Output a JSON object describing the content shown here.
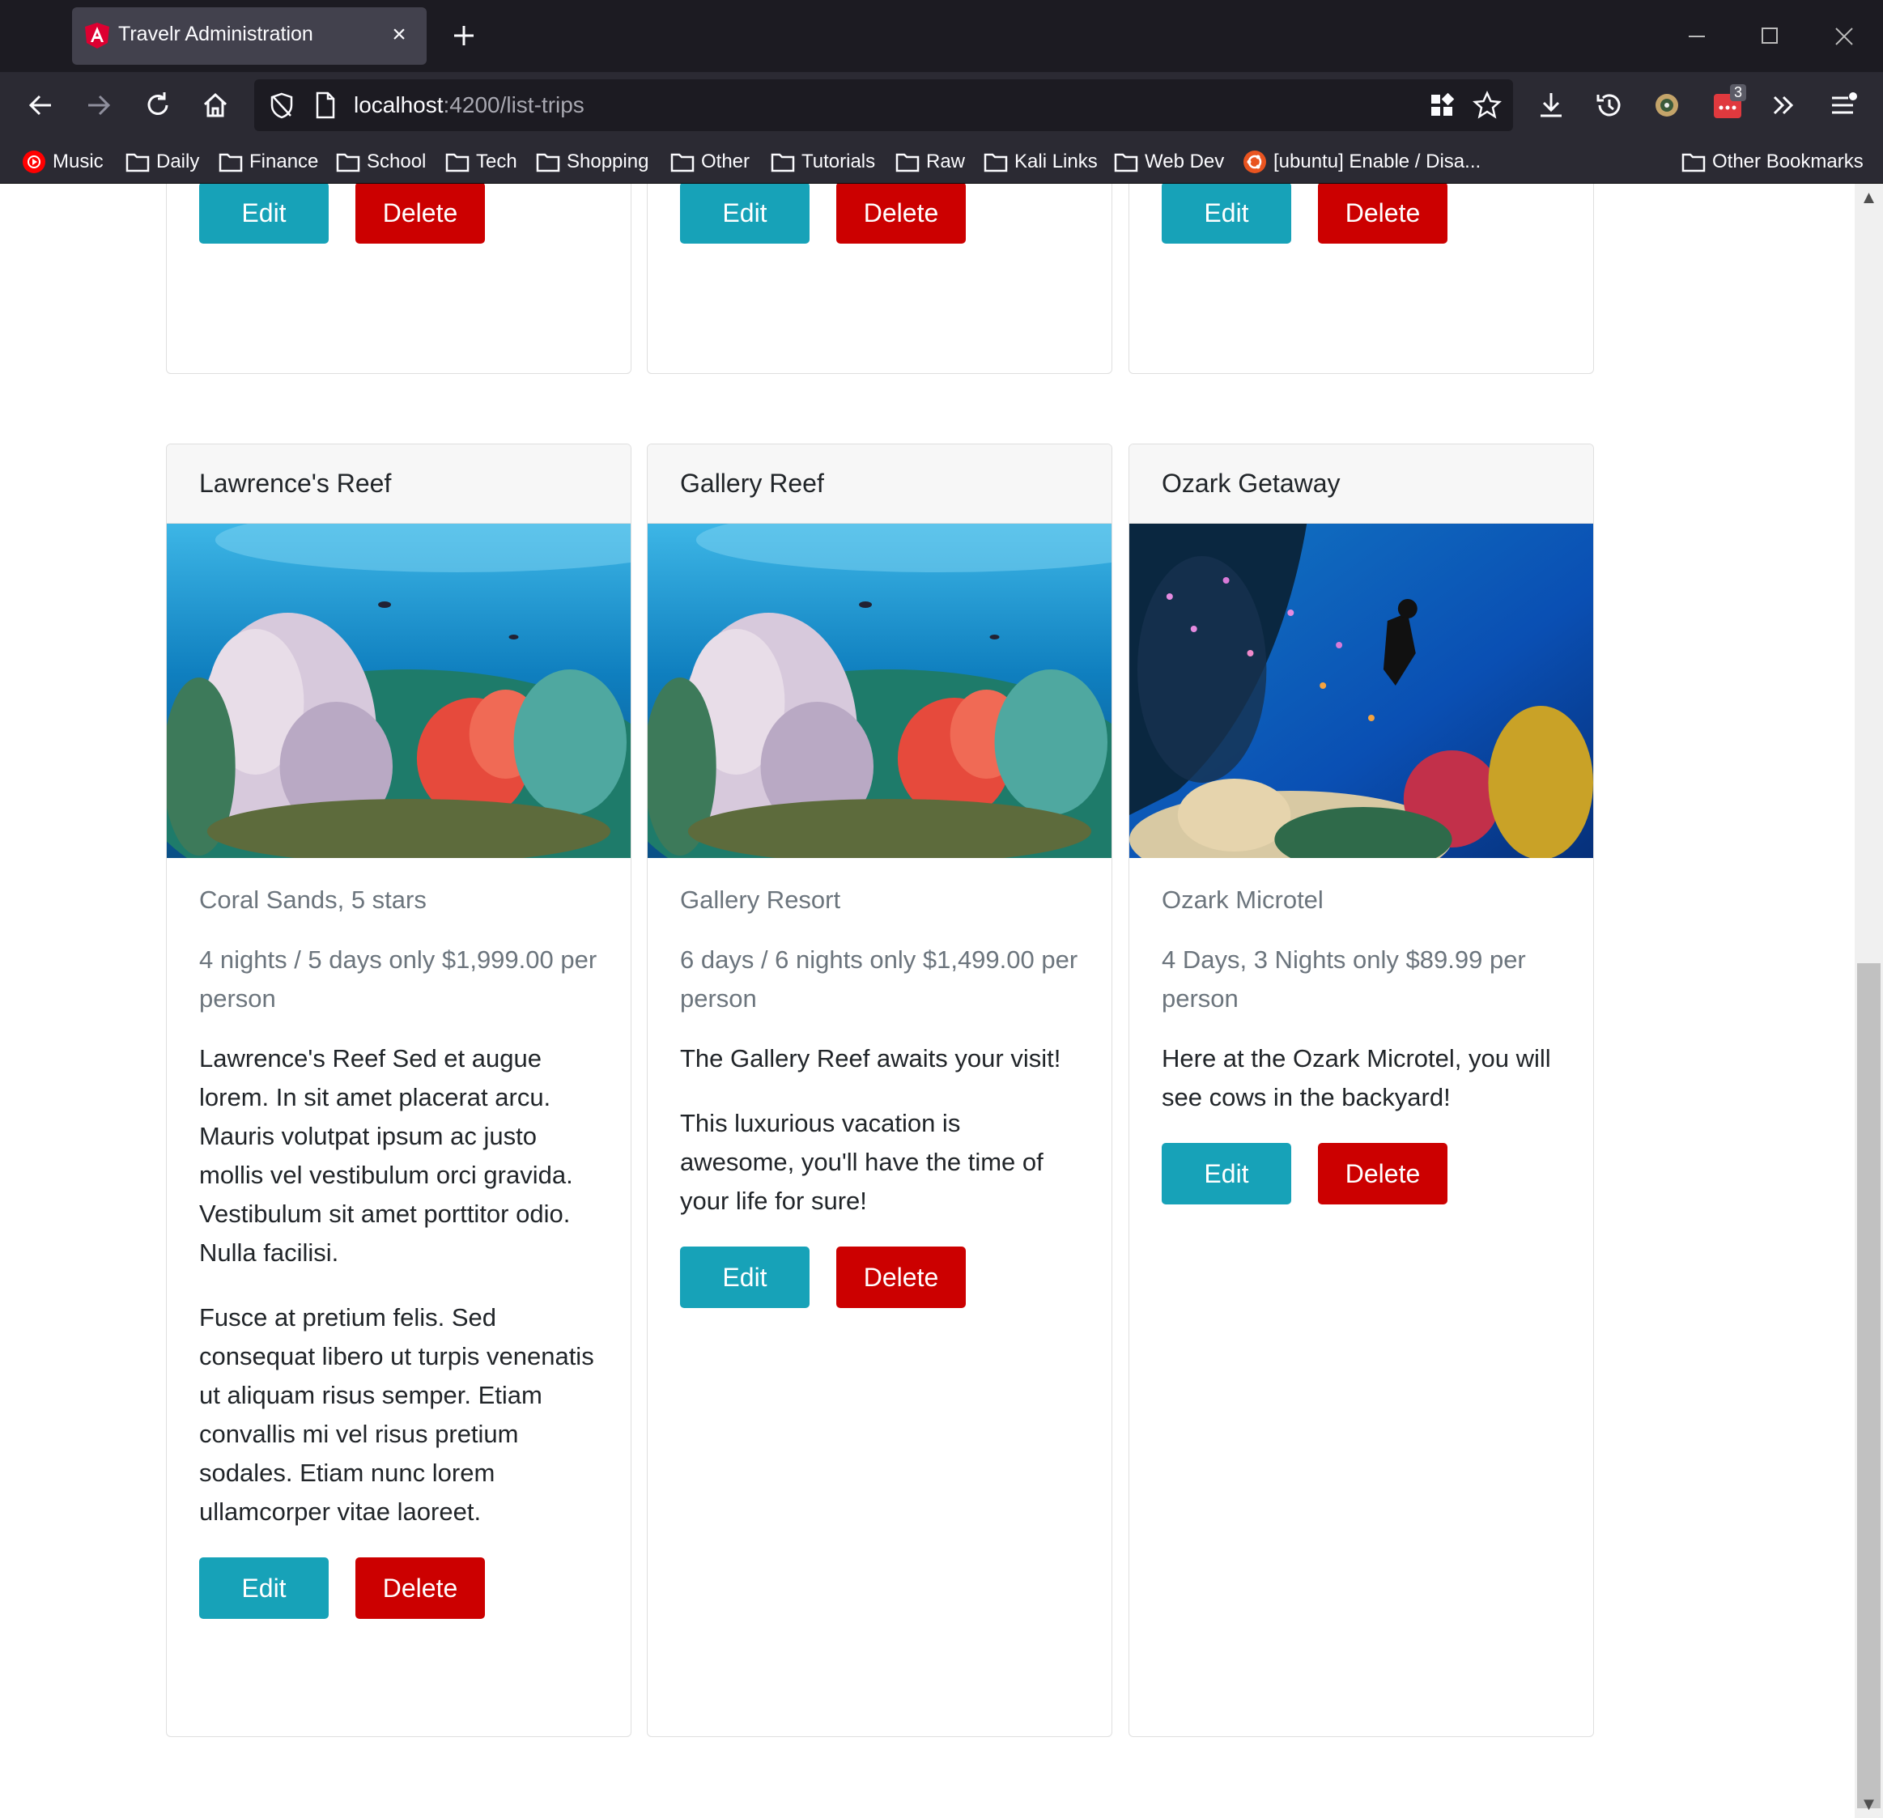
{
  "browser": {
    "tab_title": "Travelr Administration",
    "url_host": "localhost",
    "url_path": ":4200/list-trips",
    "extension_badge": "3",
    "bookmarks": [
      "Music",
      "Daily",
      "Finance",
      "School",
      "Tech",
      "Shopping",
      "Other",
      "Tutorials",
      "Raw",
      "Kali Links",
      "Web Dev",
      "[ubuntu] Enable / Disa..."
    ],
    "other_bookmarks": "Other Bookmarks"
  },
  "colors": {
    "edit": "#17a2b8",
    "delete": "#cc0000"
  },
  "buttons": {
    "edit": "Edit",
    "delete": "Delete"
  },
  "trips": [
    {
      "name": "Lawrence's Reef",
      "image": "coral-reef-photo",
      "resort": "Coral Sands, 5 stars",
      "package": "4 nights / 5 days only $1,999.00 per person",
      "description": [
        "Lawrence's Reef Sed et augue lorem. In sit amet placerat arcu. Mauris volutpat ipsum ac justo mollis vel vestibulum orci gravida. Vestibulum sit amet porttitor odio. Nulla facilisi.",
        "Fusce at pretium felis. Sed consequat libero ut turpis venenatis ut aliquam risus semper. Etiam convallis mi vel risus pretium sodales. Etiam nunc lorem ullamcorper vitae laoreet."
      ]
    },
    {
      "name": "Gallery Reef",
      "image": "coral-reef-photo",
      "resort": "Gallery Resort",
      "package": "6 days / 6 nights only $1,499.00 per person",
      "description": [
        "The Gallery Reef awaits your visit!",
        "This luxurious vacation is awesome, you'll have the time of your life for sure!"
      ]
    },
    {
      "name": "Ozark Getaway",
      "image": "scuba-diver-reef-photo",
      "resort": "Ozark Microtel",
      "package": "4 Days, 3 Nights only $89.99 per person",
      "description": [
        "Here at the Ozark Microtel, you will see cows in the backyard!"
      ]
    }
  ]
}
